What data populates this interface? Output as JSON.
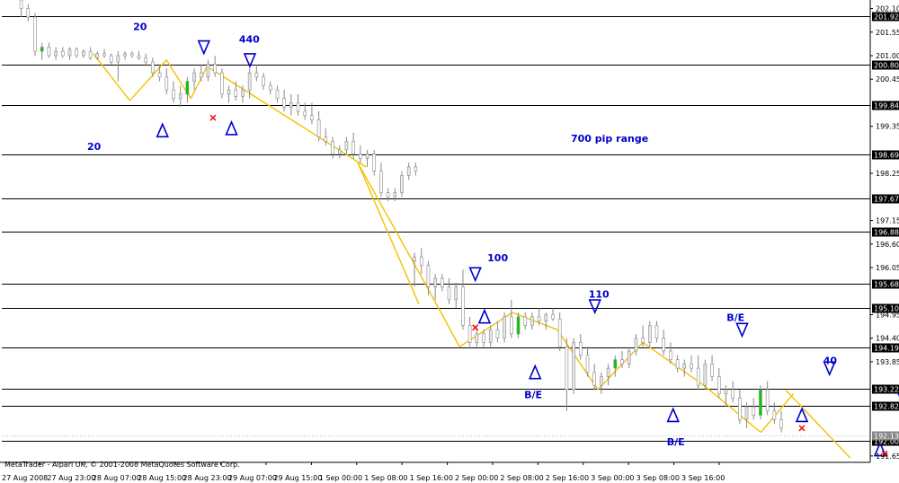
{
  "watermark": "MetaTrader - Alpari UK, © 2001-2008 MetaQuotes Software Corp.",
  "colors": {
    "background": "#ffffff",
    "axis": "#000000",
    "level_line": "#000000",
    "level_label_bg": "#000000",
    "bull_candle": "#e8e8e8",
    "bear_candle": "#ffffff",
    "candle_outline": "#888888",
    "bull_highlight": "#00cc00",
    "trend_line": "#f2c200",
    "annotation": "#0000cc",
    "cross": "#ff0000"
  },
  "chart_data": {
    "type": "candlestick",
    "instrument_scale": "price",
    "ylim": [
      191.5,
      202.3
    ],
    "y_ticks": [
      "202.10",
      "201.55",
      "201.00",
      "200.45",
      "199.35",
      "198.25",
      "197.15",
      "196.60",
      "196.05",
      "194.95",
      "194.40",
      "193.85",
      "191.65"
    ],
    "x_ticks": [
      "27 Aug 2008",
      "27 Aug 23:00",
      "28 Aug 07:00",
      "28 Aug 15:00",
      "28 Aug 23:00",
      "29 Aug 07:00",
      "29 Aug 15:00",
      "1 Sep 00:00",
      "1 Sep 08:00",
      "1 Sep 16:00",
      "2 Sep 00:00",
      "2 Sep 08:00",
      "2 Sep 16:00",
      "3 Sep 00:00",
      "3 Sep 08:00",
      "3 Sep 16:00"
    ],
    "levels": [
      "201.92",
      "200.80",
      "199.84",
      "198.69",
      "197.67",
      "196.88",
      "195.68",
      "195.10",
      "194.19",
      "193.22",
      "192.82",
      "192.00"
    ],
    "last_price_label": "192.13",
    "range_label": "700 pip range",
    "annotations": [
      {
        "text": "20",
        "x": 26,
        "y": 201.6
      },
      {
        "text": "440",
        "x": 49,
        "y": 201.3
      },
      {
        "text": "20",
        "x": 16,
        "y": 198.8
      },
      {
        "text": "100",
        "x": 103,
        "y": 196.2
      },
      {
        "text": "110",
        "x": 125,
        "y": 195.35
      },
      {
        "text": "B/E",
        "x": 111,
        "y": 193.0
      },
      {
        "text": "B/E",
        "x": 155,
        "y": 194.8
      },
      {
        "text": "B/E",
        "x": 142,
        "y": 191.9
      },
      {
        "text": "40",
        "x": 176,
        "y": 193.8
      }
    ],
    "arrows_down": [
      {
        "x": 40,
        "y": 201.05
      },
      {
        "x": 50,
        "y": 200.75
      },
      {
        "x": 99,
        "y": 195.75
      },
      {
        "x": 125,
        "y": 195.0
      },
      {
        "x": 157,
        "y": 194.45
      },
      {
        "x": 176,
        "y": 193.55
      },
      {
        "x": 192,
        "y": 192.85
      }
    ],
    "arrows_up": [
      {
        "x": 31,
        "y": 199.4
      },
      {
        "x": 46,
        "y": 199.45
      },
      {
        "x": 101,
        "y": 195.05
      },
      {
        "x": 112,
        "y": 193.75
      },
      {
        "x": 142,
        "y": 192.75
      },
      {
        "x": 170,
        "y": 192.75
      },
      {
        "x": 187,
        "y": 191.95
      }
    ],
    "crosses": [
      {
        "x": 42,
        "y": 199.55
      },
      {
        "x": 99,
        "y": 194.65
      },
      {
        "x": 170,
        "y": 192.3
      },
      {
        "x": 188,
        "y": 191.7
      }
    ],
    "trend_lines": [
      {
        "x1": 22,
        "y1": 201.05,
        "x2": 31,
        "y2": 199.95
      },
      {
        "x1": 31,
        "y1": 199.95,
        "x2": 40,
        "y2": 200.9
      },
      {
        "x1": 40,
        "y1": 200.9,
        "x2": 46,
        "y2": 200.0
      },
      {
        "x1": 46,
        "y1": 200.0,
        "x2": 50,
        "y2": 200.75
      },
      {
        "x1": 50,
        "y1": 200.75,
        "x2": 89,
        "y2": 198.4
      },
      {
        "x1": 87,
        "y1": 198.5,
        "x2": 104,
        "y2": 195.6
      },
      {
        "x1": 87,
        "y1": 198.5,
        "x2": 102,
        "y2": 195.2
      },
      {
        "x1": 104,
        "y1": 195.6,
        "x2": 112,
        "y2": 194.2
      },
      {
        "x1": 112,
        "y1": 194.2,
        "x2": 125,
        "y2": 195.0
      },
      {
        "x1": 125,
        "y1": 195.0,
        "x2": 136,
        "y2": 194.6
      },
      {
        "x1": 136,
        "y1": 194.6,
        "x2": 146,
        "y2": 193.2
      },
      {
        "x1": 146,
        "y1": 193.2,
        "x2": 157,
        "y2": 194.3
      },
      {
        "x1": 157,
        "y1": 194.3,
        "x2": 172,
        "y2": 193.3
      },
      {
        "x1": 172,
        "y1": 193.3,
        "x2": 186,
        "y2": 192.2
      },
      {
        "x1": 186,
        "y1": 192.2,
        "x2": 194,
        "y2": 193.1
      },
      {
        "x1": 192,
        "y1": 193.2,
        "x2": 208,
        "y2": 191.6
      }
    ],
    "candles": [
      {
        "x": 0,
        "o": 202.3,
        "h": 202.4,
        "l": 201.9,
        "c": 202.1
      },
      {
        "x": 1,
        "o": 202.1,
        "h": 202.2,
        "l": 201.8,
        "c": 201.9
      },
      {
        "x": 2,
        "o": 201.9,
        "h": 202.0,
        "l": 201.0,
        "c": 201.1
      },
      {
        "x": 3,
        "o": 201.1,
        "h": 201.3,
        "l": 200.9,
        "c": 201.2
      },
      {
        "x": 4,
        "o": 201.2,
        "h": 201.3,
        "l": 200.95,
        "c": 201.0
      },
      {
        "x": 5,
        "o": 201.0,
        "h": 201.2,
        "l": 200.9,
        "c": 201.1
      },
      {
        "x": 6,
        "o": 201.1,
        "h": 201.2,
        "l": 200.95,
        "c": 201.0
      },
      {
        "x": 7,
        "o": 201.0,
        "h": 201.2,
        "l": 200.9,
        "c": 201.15
      },
      {
        "x": 8,
        "o": 201.15,
        "h": 201.2,
        "l": 200.95,
        "c": 201.0
      },
      {
        "x": 9,
        "o": 201.0,
        "h": 201.15,
        "l": 200.95,
        "c": 201.1
      },
      {
        "x": 10,
        "o": 201.1,
        "h": 201.2,
        "l": 200.9,
        "c": 200.95
      },
      {
        "x": 11,
        "o": 200.95,
        "h": 201.1,
        "l": 200.9,
        "c": 201.05
      },
      {
        "x": 12,
        "o": 201.05,
        "h": 201.15,
        "l": 200.95,
        "c": 201.0
      },
      {
        "x": 13,
        "o": 201.0,
        "h": 201.05,
        "l": 200.8,
        "c": 200.85
      },
      {
        "x": 14,
        "o": 200.85,
        "h": 201.1,
        "l": 200.4,
        "c": 201.0
      },
      {
        "x": 15,
        "o": 201.0,
        "h": 201.1,
        "l": 200.9,
        "c": 201.05
      },
      {
        "x": 16,
        "o": 201.05,
        "h": 201.1,
        "l": 200.95,
        "c": 201.0
      },
      {
        "x": 17,
        "o": 201.0,
        "h": 201.1,
        "l": 200.9,
        "c": 200.95
      },
      {
        "x": 18,
        "o": 200.95,
        "h": 201.05,
        "l": 200.8,
        "c": 200.85
      },
      {
        "x": 19,
        "o": 200.85,
        "h": 200.95,
        "l": 200.5,
        "c": 200.6
      },
      {
        "x": 20,
        "o": 200.6,
        "h": 200.8,
        "l": 200.4,
        "c": 200.5
      },
      {
        "x": 21,
        "o": 200.5,
        "h": 200.7,
        "l": 200.1,
        "c": 200.2
      },
      {
        "x": 22,
        "o": 200.2,
        "h": 200.4,
        "l": 199.9,
        "c": 200.0
      },
      {
        "x": 23,
        "o": 200.0,
        "h": 200.3,
        "l": 199.8,
        "c": 200.1
      },
      {
        "x": 24,
        "o": 200.1,
        "h": 200.5,
        "l": 199.9,
        "c": 200.4
      },
      {
        "x": 25,
        "o": 200.4,
        "h": 200.7,
        "l": 200.2,
        "c": 200.6
      },
      {
        "x": 26,
        "o": 200.6,
        "h": 200.8,
        "l": 200.4,
        "c": 200.5
      },
      {
        "x": 27,
        "o": 200.5,
        "h": 200.9,
        "l": 200.4,
        "c": 200.8
      },
      {
        "x": 28,
        "o": 200.8,
        "h": 201.0,
        "l": 200.5,
        "c": 200.6
      },
      {
        "x": 29,
        "o": 200.6,
        "h": 200.7,
        "l": 200.0,
        "c": 200.1
      },
      {
        "x": 30,
        "o": 200.1,
        "h": 200.3,
        "l": 199.9,
        "c": 200.2
      },
      {
        "x": 31,
        "o": 200.2,
        "h": 200.4,
        "l": 199.95,
        "c": 200.05
      },
      {
        "x": 32,
        "o": 200.05,
        "h": 200.3,
        "l": 199.9,
        "c": 200.2
      },
      {
        "x": 33,
        "o": 200.2,
        "h": 200.7,
        "l": 200.0,
        "c": 200.6
      },
      {
        "x": 34,
        "o": 200.6,
        "h": 200.8,
        "l": 200.4,
        "c": 200.5
      },
      {
        "x": 35,
        "o": 200.5,
        "h": 200.6,
        "l": 200.2,
        "c": 200.3
      },
      {
        "x": 36,
        "o": 200.3,
        "h": 200.4,
        "l": 200.1,
        "c": 200.2
      },
      {
        "x": 37,
        "o": 200.2,
        "h": 200.3,
        "l": 199.9,
        "c": 200.0
      },
      {
        "x": 38,
        "o": 200.0,
        "h": 200.2,
        "l": 199.7,
        "c": 199.8
      },
      {
        "x": 39,
        "o": 199.8,
        "h": 200.1,
        "l": 199.6,
        "c": 199.9
      },
      {
        "x": 40,
        "o": 199.9,
        "h": 200.1,
        "l": 199.6,
        "c": 199.7
      },
      {
        "x": 41,
        "o": 199.7,
        "h": 199.9,
        "l": 199.5,
        "c": 199.6
      },
      {
        "x": 42,
        "o": 199.6,
        "h": 199.9,
        "l": 199.4,
        "c": 199.5
      },
      {
        "x": 43,
        "o": 199.5,
        "h": 199.7,
        "l": 199.0,
        "c": 199.1
      },
      {
        "x": 44,
        "o": 199.1,
        "h": 199.3,
        "l": 198.9,
        "c": 199.0
      },
      {
        "x": 45,
        "o": 199.0,
        "h": 199.1,
        "l": 198.6,
        "c": 198.7
      },
      {
        "x": 46,
        "o": 198.7,
        "h": 198.9,
        "l": 198.6,
        "c": 198.8
      },
      {
        "x": 47,
        "o": 198.8,
        "h": 199.1,
        "l": 198.7,
        "c": 199.0
      },
      {
        "x": 48,
        "o": 199.0,
        "h": 199.2,
        "l": 198.6,
        "c": 198.7
      },
      {
        "x": 49,
        "o": 198.7,
        "h": 198.9,
        "l": 198.5,
        "c": 198.6
      },
      {
        "x": 50,
        "o": 198.6,
        "h": 198.8,
        "l": 198.4,
        "c": 198.7
      },
      {
        "x": 51,
        "o": 198.7,
        "h": 198.8,
        "l": 198.2,
        "c": 198.3
      },
      {
        "x": 52,
        "o": 198.3,
        "h": 198.5,
        "l": 197.7,
        "c": 197.8
      },
      {
        "x": 53,
        "o": 197.8,
        "h": 197.9,
        "l": 197.6,
        "c": 197.7
      },
      {
        "x": 54,
        "o": 197.7,
        "h": 197.9,
        "l": 197.6,
        "c": 197.8
      },
      {
        "x": 55,
        "o": 197.8,
        "h": 198.3,
        "l": 197.7,
        "c": 198.2
      },
      {
        "x": 56,
        "o": 198.2,
        "h": 198.5,
        "l": 198.1,
        "c": 198.4
      },
      {
        "x": 57,
        "o": 198.4,
        "h": 198.5,
        "l": 198.2,
        "c": 198.3
      },
      {
        "x": 58,
        "o": 196.2,
        "h": 196.4,
        "l": 195.6,
        "c": 196.3
      },
      {
        "x": 59,
        "o": 196.3,
        "h": 196.5,
        "l": 195.9,
        "c": 196.1
      },
      {
        "x": 60,
        "o": 196.1,
        "h": 196.2,
        "l": 195.4,
        "c": 195.6
      },
      {
        "x": 61,
        "o": 195.6,
        "h": 195.9,
        "l": 195.3,
        "c": 195.8
      },
      {
        "x": 62,
        "o": 195.8,
        "h": 195.9,
        "l": 195.5,
        "c": 195.6
      },
      {
        "x": 63,
        "o": 195.6,
        "h": 195.8,
        "l": 195.2,
        "c": 195.3
      },
      {
        "x": 64,
        "o": 195.3,
        "h": 195.7,
        "l": 195.1,
        "c": 195.6
      },
      {
        "x": 65,
        "o": 195.6,
        "h": 196.0,
        "l": 194.6,
        "c": 194.7
      },
      {
        "x": 66,
        "o": 194.7,
        "h": 194.9,
        "l": 194.2,
        "c": 194.3
      },
      {
        "x": 67,
        "o": 194.3,
        "h": 194.6,
        "l": 194.2,
        "c": 194.5
      },
      {
        "x": 68,
        "o": 194.5,
        "h": 194.6,
        "l": 194.2,
        "c": 194.3
      },
      {
        "x": 69,
        "o": 194.3,
        "h": 194.7,
        "l": 194.2,
        "c": 194.6
      },
      {
        "x": 70,
        "o": 194.6,
        "h": 194.8,
        "l": 194.3,
        "c": 194.4
      },
      {
        "x": 71,
        "o": 194.4,
        "h": 195.0,
        "l": 194.3,
        "c": 194.9
      },
      {
        "x": 72,
        "o": 194.9,
        "h": 195.3,
        "l": 194.4,
        "c": 194.5
      },
      {
        "x": 73,
        "o": 194.5,
        "h": 195.0,
        "l": 194.4,
        "c": 194.9
      },
      {
        "x": 74,
        "o": 194.9,
        "h": 195.0,
        "l": 194.6,
        "c": 194.7
      },
      {
        "x": 75,
        "o": 194.7,
        "h": 195.0,
        "l": 194.6,
        "c": 194.9
      },
      {
        "x": 76,
        "o": 194.9,
        "h": 195.1,
        "l": 194.7,
        "c": 194.8
      },
      {
        "x": 77,
        "o": 194.8,
        "h": 195.0,
        "l": 194.6,
        "c": 194.95
      },
      {
        "x": 78,
        "o": 194.95,
        "h": 195.1,
        "l": 194.8,
        "c": 194.85
      },
      {
        "x": 79,
        "o": 194.85,
        "h": 195.0,
        "l": 194.1,
        "c": 194.2
      },
      {
        "x": 80,
        "o": 194.2,
        "h": 194.4,
        "l": 192.7,
        "c": 193.2
      },
      {
        "x": 81,
        "o": 193.2,
        "h": 194.4,
        "l": 193.1,
        "c": 194.3
      },
      {
        "x": 82,
        "o": 194.3,
        "h": 194.5,
        "l": 193.9,
        "c": 194.0
      },
      {
        "x": 83,
        "o": 194.0,
        "h": 194.2,
        "l": 193.5,
        "c": 193.6
      },
      {
        "x": 84,
        "o": 193.6,
        "h": 193.8,
        "l": 193.2,
        "c": 193.3
      },
      {
        "x": 85,
        "o": 193.3,
        "h": 193.6,
        "l": 193.1,
        "c": 193.5
      },
      {
        "x": 86,
        "o": 193.5,
        "h": 193.8,
        "l": 193.3,
        "c": 193.7
      },
      {
        "x": 87,
        "o": 193.7,
        "h": 194.0,
        "l": 193.5,
        "c": 193.9
      },
      {
        "x": 88,
        "o": 193.9,
        "h": 194.1,
        "l": 193.7,
        "c": 193.8
      },
      {
        "x": 89,
        "o": 193.8,
        "h": 194.2,
        "l": 193.7,
        "c": 194.1
      },
      {
        "x": 90,
        "o": 194.1,
        "h": 194.5,
        "l": 194.0,
        "c": 194.4
      },
      {
        "x": 91,
        "o": 194.4,
        "h": 194.7,
        "l": 194.2,
        "c": 194.3
      },
      {
        "x": 92,
        "o": 194.3,
        "h": 194.8,
        "l": 194.2,
        "c": 194.7
      },
      {
        "x": 93,
        "o": 194.7,
        "h": 194.8,
        "l": 194.3,
        "c": 194.4
      },
      {
        "x": 94,
        "o": 194.4,
        "h": 194.6,
        "l": 194.0,
        "c": 194.1
      },
      {
        "x": 95,
        "o": 194.1,
        "h": 194.3,
        "l": 193.8,
        "c": 193.9
      },
      {
        "x": 96,
        "o": 193.9,
        "h": 194.0,
        "l": 193.6,
        "c": 193.7
      },
      {
        "x": 97,
        "o": 193.7,
        "h": 193.9,
        "l": 193.5,
        "c": 193.8
      },
      {
        "x": 98,
        "o": 193.8,
        "h": 194.0,
        "l": 193.6,
        "c": 193.7
      },
      {
        "x": 99,
        "o": 193.7,
        "h": 194.0,
        "l": 193.2,
        "c": 193.3
      },
      {
        "x": 100,
        "o": 193.3,
        "h": 193.9,
        "l": 193.2,
        "c": 193.8
      },
      {
        "x": 101,
        "o": 193.8,
        "h": 194.0,
        "l": 193.4,
        "c": 193.5
      },
      {
        "x": 102,
        "o": 193.5,
        "h": 193.7,
        "l": 193.0,
        "c": 193.1
      },
      {
        "x": 103,
        "o": 193.1,
        "h": 193.3,
        "l": 192.8,
        "c": 193.2
      },
      {
        "x": 104,
        "o": 193.2,
        "h": 193.4,
        "l": 192.9,
        "c": 193.0
      },
      {
        "x": 105,
        "o": 193.0,
        "h": 193.2,
        "l": 192.4,
        "c": 192.5
      },
      {
        "x": 106,
        "o": 192.5,
        "h": 192.9,
        "l": 192.3,
        "c": 192.8
      },
      {
        "x": 107,
        "o": 192.8,
        "h": 193.0,
        "l": 192.5,
        "c": 192.6
      },
      {
        "x": 108,
        "o": 192.6,
        "h": 193.3,
        "l": 192.5,
        "c": 193.2
      },
      {
        "x": 109,
        "o": 193.2,
        "h": 193.4,
        "l": 192.6,
        "c": 192.7
      },
      {
        "x": 110,
        "o": 192.7,
        "h": 192.9,
        "l": 192.4,
        "c": 192.5
      },
      {
        "x": 111,
        "o": 192.5,
        "h": 192.7,
        "l": 192.2,
        "c": 192.3
      }
    ]
  }
}
